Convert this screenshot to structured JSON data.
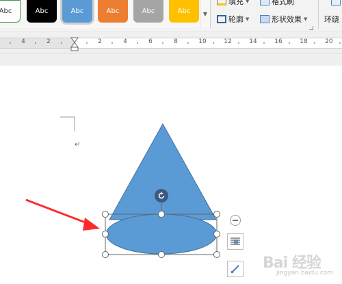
{
  "ribbon": {
    "style_gallery": {
      "swatches": [
        {
          "label": "Abc",
          "color": "#ffffff"
        },
        {
          "label": "Abc",
          "color": "#000000"
        },
        {
          "label": "Abc",
          "color": "#5b9bd5"
        },
        {
          "label": "Abc",
          "color": "#ed7d31"
        },
        {
          "label": "Abc",
          "color": "#a5a5a5"
        },
        {
          "label": "Abc",
          "color": "#ffc000"
        }
      ],
      "selected_index": 2
    },
    "fill_label": "填充",
    "format_painter_label": "格式刷",
    "outline_label": "轮廓",
    "shape_effects_label": "形状效果",
    "wrap_label": "环绕"
  },
  "ruler": {
    "ticks": [
      "4",
      "2",
      "2",
      "4",
      "6",
      "8",
      "10",
      "12",
      "14",
      "16",
      "18",
      "20"
    ]
  },
  "document": {
    "paragraph_mark": "↵"
  },
  "shapes": {
    "fill_color": "#5b9bd5",
    "outline_color": "#41719c",
    "annotation_arrow_color": "#ff2a2a"
  },
  "watermark": {
    "brand": "Bai 经验",
    "domain": "jingyan.baidu.com"
  }
}
